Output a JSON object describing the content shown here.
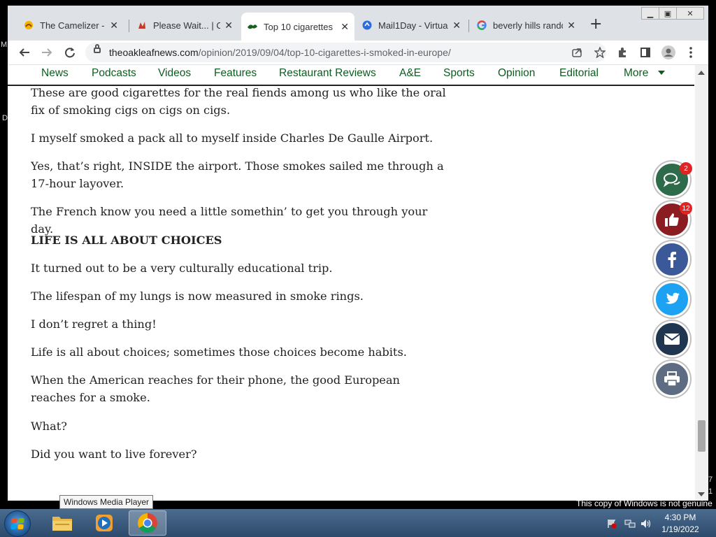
{
  "browser": {
    "tabs": [
      {
        "label": "The Camelizer - Cl",
        "icon": "camelizer-icon"
      },
      {
        "label": "Please Wait... | Clo",
        "icon": "cloudflare-icon"
      },
      {
        "label": "Top 10 cigarettes",
        "icon": "oakleaf-icon",
        "active": true
      },
      {
        "label": "Mail1Day - Virtual",
        "icon": "mail1day-icon"
      },
      {
        "label": "beverly hills rando",
        "icon": "google-icon"
      }
    ],
    "url_domain": "theoakleafnews.com",
    "url_path": "/opinion/2019/09/04/top-10-cigarettes-i-smoked-in-europe/"
  },
  "site_nav": {
    "items": [
      "News",
      "Podcasts",
      "Videos",
      "Features",
      "Restaurant Reviews",
      "A&E",
      "Sports",
      "Opinion",
      "Editorial",
      "More"
    ]
  },
  "article": {
    "paragraphs": [
      {
        "text": "These are good cigarettes for the real fiends among us who like the oral fix of smoking cigs on cigs on cigs."
      },
      {
        "text": "I myself smoked a pack all to myself inside Charles De Gaulle Airport."
      },
      {
        "text": "Yes, that’s right, INSIDE the airport. Those smokes sailed me through a 17-hour layover."
      },
      {
        "text": "The French know you need a little somethin’ to get you through your day."
      },
      {
        "text": "LIFE IS ALL ABOUT CHOICES",
        "bold": true
      },
      {
        "text": "It turned out to be a very culturally educational trip."
      },
      {
        "text": "The lifespan of my lungs is now measured in smoke rings."
      },
      {
        "text": "I don’t regret a thing!"
      },
      {
        "text": "Life is all about choices; sometimes those choices become habits."
      },
      {
        "text": "When the American reaches for their phone, the good European reaches for a smoke."
      },
      {
        "text": "What?"
      },
      {
        "text": "Did you want to live forever?"
      }
    ]
  },
  "share_buttons": {
    "comments_count": "2",
    "likes_count": "12",
    "colors": {
      "comments": "#2e6b4a",
      "likes": "#8b1c22",
      "facebook": "#3b5998",
      "twitter": "#1da1f2",
      "email": "#1f3550",
      "print": "#5d6c82"
    }
  },
  "taskbar": {
    "tooltip": "Windows Media Player",
    "time": "4:30 PM",
    "date": "1/19/2022",
    "watermark": "This copy of Windows is not genuine"
  },
  "desktop": {
    "edge_left_1": "M",
    "edge_left_2": "D",
    "edge_right_1": "7",
    "edge_right_2": "1"
  }
}
